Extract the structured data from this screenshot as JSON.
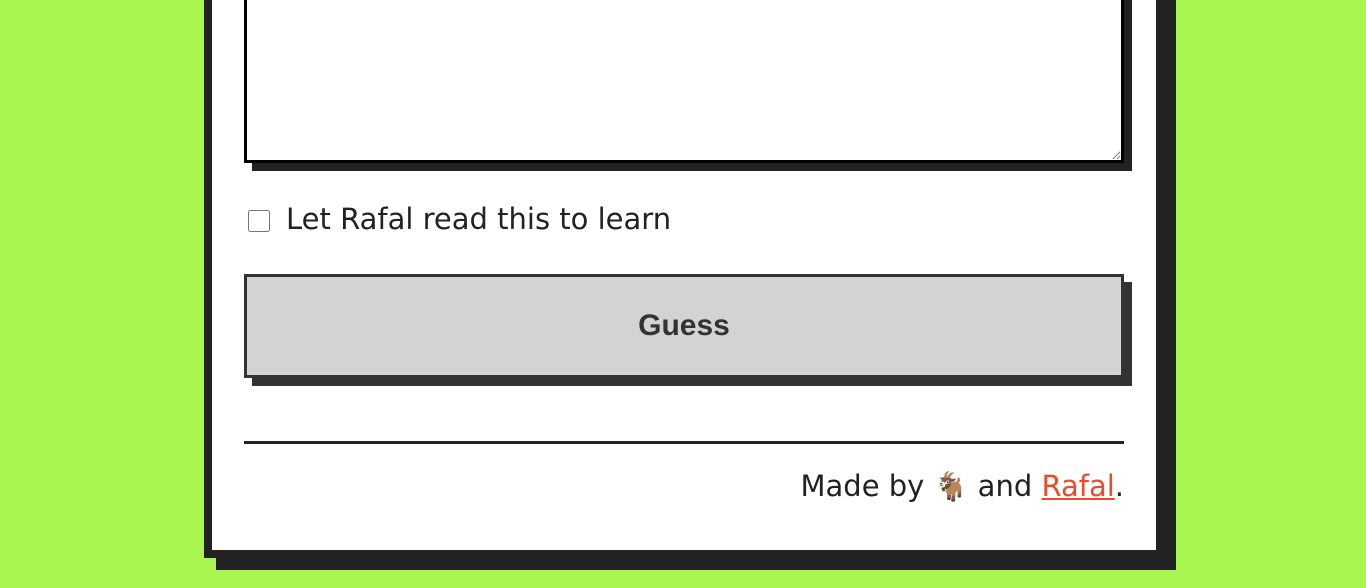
{
  "form": {
    "textarea_value": "",
    "checkbox_label": "Let Rafal read this to learn",
    "checkbox_checked": false,
    "guess_button_label": "Guess"
  },
  "footer": {
    "prefix": "Made by",
    "goat_emoji": "🐐",
    "and": "and",
    "link_text": "Rafal",
    "suffix": "."
  },
  "colors": {
    "background": "#a9f64e",
    "link": "#ea4c2a",
    "button": "#d3d3d3"
  }
}
